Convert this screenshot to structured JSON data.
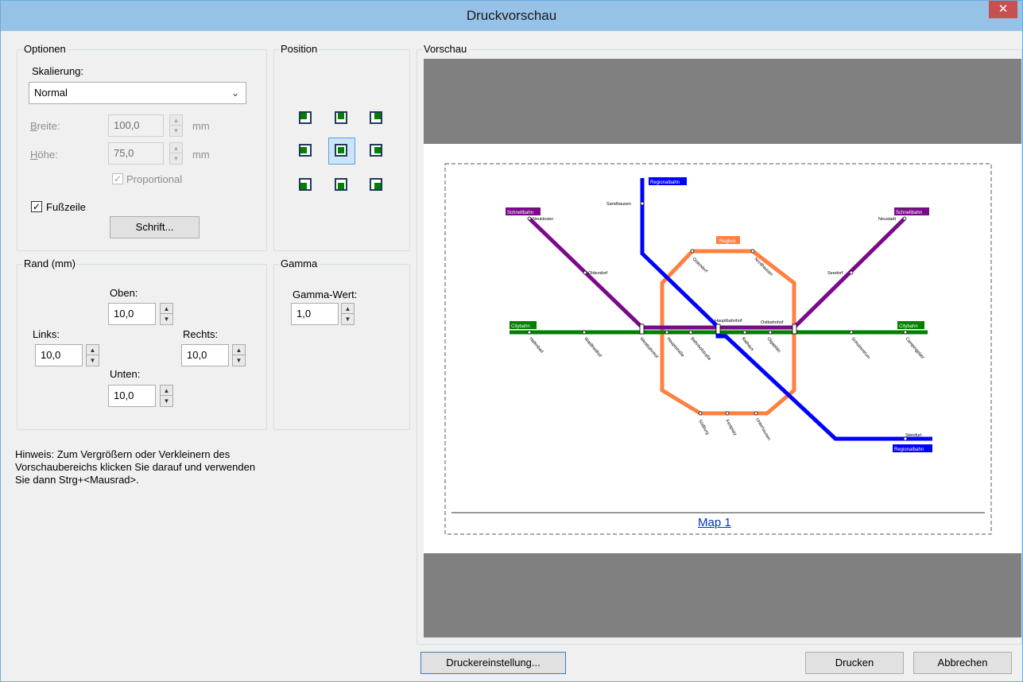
{
  "window": {
    "title": "Druckvorschau",
    "close_glyph": "✕"
  },
  "optionen": {
    "group_label": "Optionen",
    "skalierung_label": "Skalierung:",
    "skalierung_value": "Normal",
    "breite_label": "Breite:",
    "breite_value": "100,0",
    "hoehe_label": "Höhe:",
    "hoehe_value": "75,0",
    "unit": "mm",
    "proportional_label": "Proportional",
    "proportional_checked": true,
    "fusszeile_label": "Fußzeile",
    "fusszeile_checked": true,
    "schrift_button": "Schrift..."
  },
  "position": {
    "group_label": "Position",
    "selected": "center"
  },
  "rand": {
    "group_label": "Rand (mm)",
    "oben_label": "Oben:",
    "oben_value": "10,0",
    "links_label": "Links:",
    "links_value": "10,0",
    "rechts_label": "Rechts:",
    "rechts_value": "10,0",
    "unten_label": "Unten:",
    "unten_value": "10,0"
  },
  "gamma": {
    "group_label": "Gamma",
    "wert_label": "Gamma-Wert:",
    "wert_value": "1,0"
  },
  "hint": {
    "line1": "Hinweis: Zum Vergrößern oder Verkleinern des",
    "line2": "Vorschaubereichs klicken Sie darauf und verwenden",
    "line3": "Sie dann Strg+<Mausrad>."
  },
  "vorschau": {
    "group_label": "Vorschau",
    "footer_link": "Map 1",
    "map": {
      "lines": [
        {
          "name": "Regionalbahn",
          "color": "#0000ff"
        },
        {
          "name": "Schnellbahn",
          "color": "#7b0a8a"
        },
        {
          "name": "Citybahn",
          "color": "#008000"
        },
        {
          "name": "Regbus",
          "color": "#ff8040"
        }
      ],
      "labels": {
        "regionalbahn_top": "Regionalbahn",
        "regionalbahn_bottom": "Regionalbahn",
        "schnellbahn_left": "Schnellbahn",
        "schnellbahn_right": "Schnellbahn",
        "citybahn_left": "Citybahn",
        "citybahn_right": "Citybahn",
        "regbus": "Regbus"
      },
      "stations": {
        "sandhausen": "Sandhausen",
        "neukloster": "Neukloster",
        "oldendorf": "Oldendorf",
        "neustadt": "Neustadt",
        "seedorf": "Seedorf",
        "hauptbahnhof": "Hauptbahnhof",
        "ostbahnhof": "Ostbahnhof",
        "steinfurt": "Steinfurt",
        "ostendorf": "Ostendorf",
        "nordhausen": "Nordhausen",
        "hafenbad": "Hafenbad",
        "waldfriedhof": "Waldfriedhof",
        "westbahnhof": "Westbahnhof",
        "hauptstrasse": "Hauptstraße",
        "bahnhofstrasse": "Bahnhofstraße",
        "rathaus": "Rathaus",
        "olgaplatz": "Olgaplatz",
        "schulzentrum": "Schulzentrum",
        "campingplatz": "Campingplatz",
        "suedburg": "Südburg",
        "festplatz": "Festplatz",
        "unterhausen": "Unterhausen"
      }
    }
  },
  "buttons": {
    "druckereinstellung": "Druckereinstellung...",
    "drucken": "Drucken",
    "abbrechen": "Abbrechen"
  }
}
